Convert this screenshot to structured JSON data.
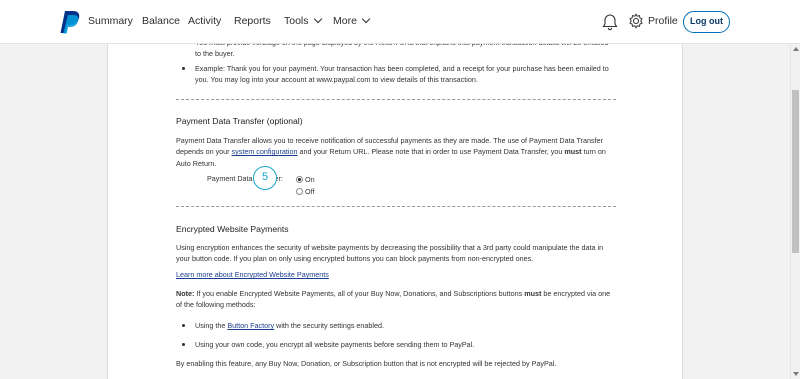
{
  "nav": {
    "items": [
      "Summary",
      "Balance",
      "Activity",
      "Reports",
      "Tools",
      "More"
    ],
    "profile": "Profile",
    "logout": "Log out",
    "icons": {
      "logo": "paypal-logo-icon",
      "bell": "bell-icon",
      "gear": "gear-icon",
      "chevron": "chevron-down-icon"
    },
    "colors": {
      "brand_blue": "#0070ba",
      "logo_dark": "#003087",
      "logo_light": "#009cde"
    }
  },
  "content": {
    "top_bullets": [
      "You must provide verbiage on the page displayed by the Return URL that explains that payment transaction details will be emailed to the buyer.",
      "Example: Thank you for your payment. Your transaction has been completed, and a receipt for your purchase has been emailed to you. You may log into your account at www.paypal.com to view details of this transaction."
    ],
    "pdt": {
      "title": "Payment Data Transfer (optional)",
      "desc_1": "Payment Data Transfer allows you to receive notification of successful payments as they are made. The use of Payment Data Transfer depends on your ",
      "desc_link": "system configuration",
      "desc_2": " and your Return URL. Please note that in order to use Payment Data Transfer, you ",
      "desc_bold": "must",
      "desc_3": " turn on Auto Return.",
      "label": "Payment Data Transfer:",
      "option_on": "On",
      "option_off": "Off",
      "selected": "On",
      "step_number": "5",
      "step_color": "#16a6c9"
    },
    "ewp": {
      "title": "Encrypted Website Payments",
      "desc": "Using encryption enhances the security of website payments by decreasing the possibility that a 3rd party could manipulate the data in your button code. If you plan on only using encrypted buttons you can block payments from non-encrypted ones.",
      "learn_link": "Learn more about Encrypted Website Payments",
      "note_bold": "Note:",
      "note_1": " If you enable Encrypted Website Payments, all of your Buy Now, Donations, and Subscriptions buttons ",
      "note_bold2": "must",
      "note_2": " be encrypted via one of the following methods:",
      "bullet_1_pre": "Using the ",
      "bullet_1_link": "Button Factory",
      "bullet_1_post": " with the security settings enabled.",
      "bullet_2": "Using your own code, you encrypt all website payments before sending them to PayPal.",
      "footer": "By enabling this feature, any Buy Now, Donation, or Subscription button that is not encrypted will be rejected by PayPal."
    }
  }
}
